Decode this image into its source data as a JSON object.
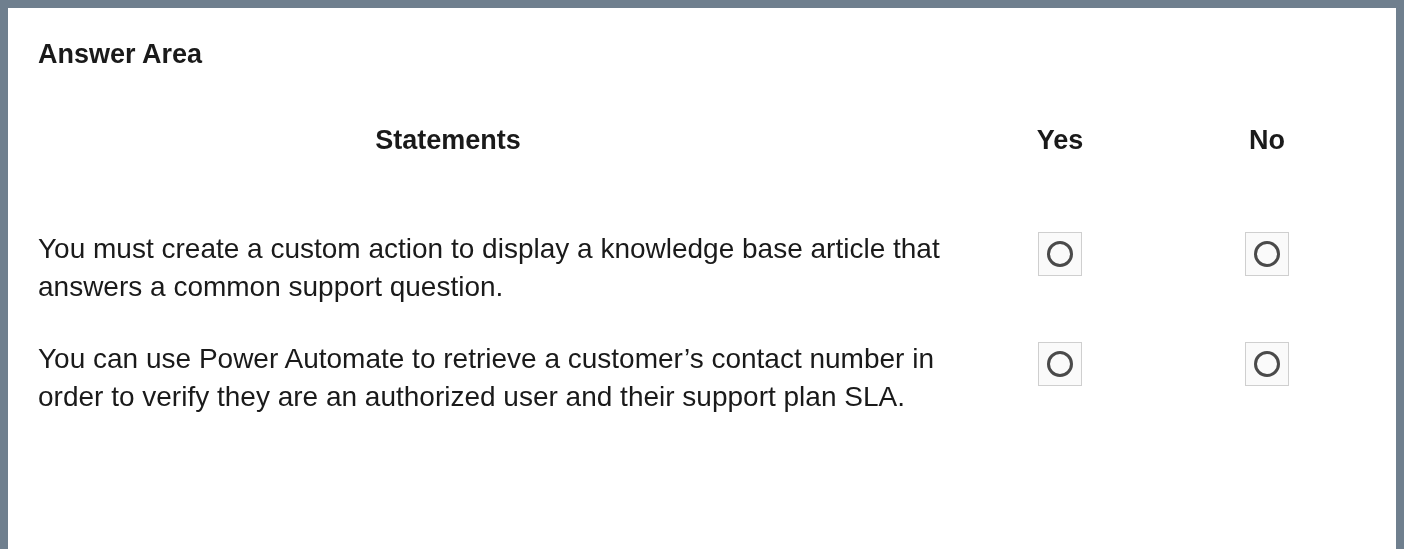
{
  "title": "Answer Area",
  "columns": {
    "statements": "Statements",
    "yes": "Yes",
    "no": "No"
  },
  "rows": [
    {
      "text": "You must create a custom action to display a knowledge base article that answers a common support question.",
      "yes": {
        "selected": false
      },
      "no": {
        "selected": false
      }
    },
    {
      "text": "You can use Power Automate to retrieve a customer’s contact number in order to verify they are an authorized user and their support plan SLA.",
      "yes": {
        "selected": false
      },
      "no": {
        "selected": false
      }
    }
  ]
}
